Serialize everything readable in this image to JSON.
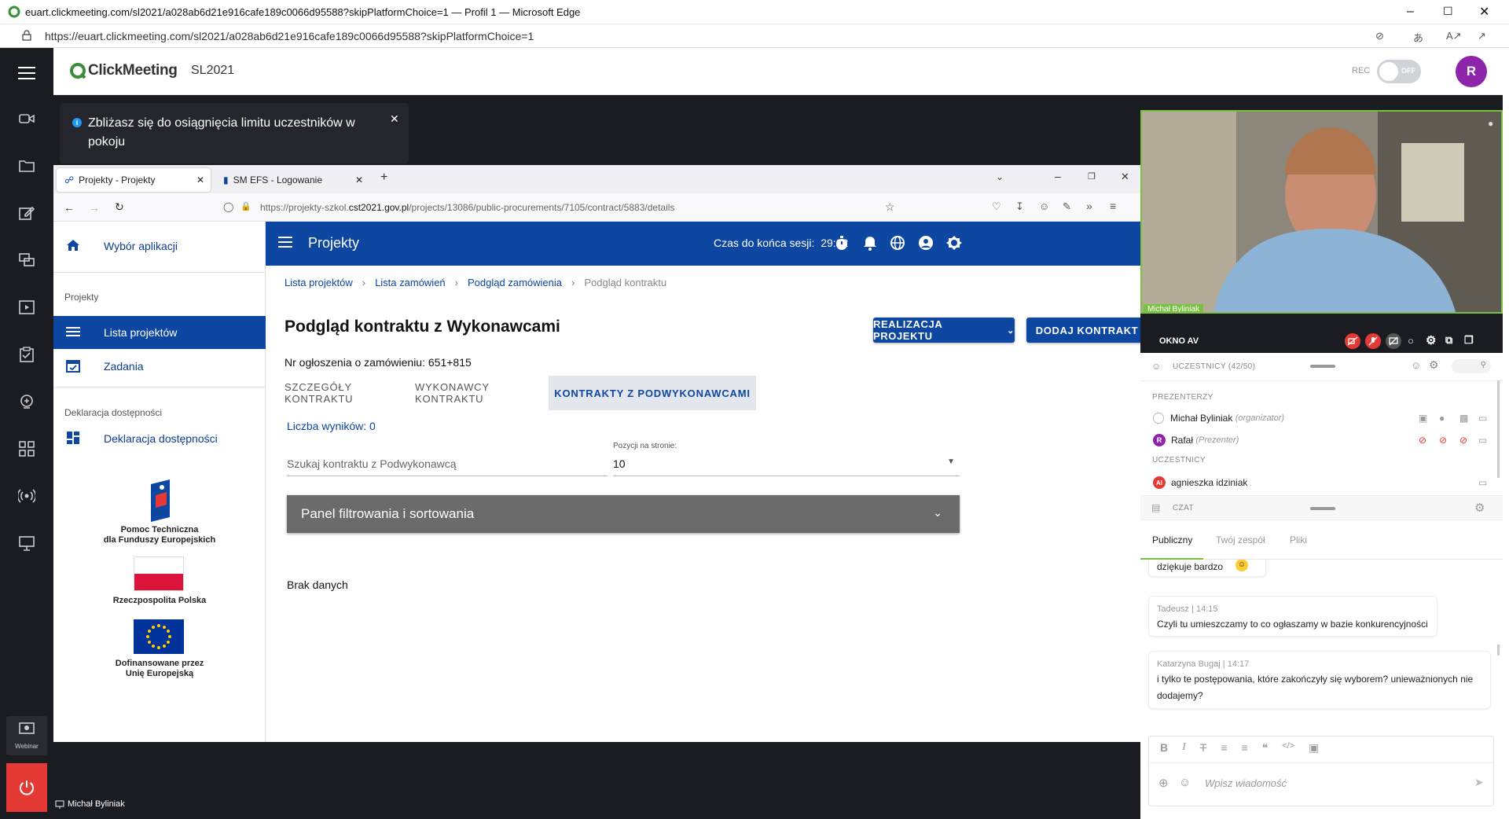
{
  "window": {
    "title": "euart.clickmeeting.com/sl2021/a028ab6d21e916cafe189c0066d95588?skipPlatformChoice=1 — Profil 1 — Microsoft Edge",
    "url": "https://euart.clickmeeting.com/sl2021/a028ab6d21e916cafe189c0066d95588?skipPlatformChoice=1"
  },
  "cm": {
    "brand": "ClickMeeting",
    "room": "SL2021",
    "rec_label": "REC",
    "rec_toggle": "OFF",
    "avatar": "R",
    "webinar_label": "Webinar",
    "bottom_presenter": "Michał Byliniak"
  },
  "toast": {
    "text": "Zbliżasz się do osiągnięcia limitu uczestników w pokoju"
  },
  "firefox": {
    "tabs": [
      {
        "label": "Projekty - Projekty"
      },
      {
        "label": "SM EFS - Logowanie"
      }
    ],
    "url_prefix": "https://projekty-szkol.",
    "url_domain": "cst2021.gov.pl",
    "url_path": "/projects/13086/public-procurements/7105/contract/5883/details"
  },
  "app": {
    "nav": {
      "app_choice": "Wybór aplikacji",
      "projects_header": "Projekty",
      "projects_list": "Lista projektów",
      "tasks": "Zadania",
      "accessibility_header": "Deklaracja dostępności",
      "accessibility": "Deklaracja dostępności",
      "logo1_line1": "Pomoc Techniczna",
      "logo1_line2": "dla Funduszy Europejskich",
      "logo2": "Rzeczpospolita Polska",
      "logo3_line1": "Dofinansowane przez",
      "logo3_line2": "Unię Europejską"
    },
    "appbar": {
      "title": "Projekty",
      "session_label": "Czas do końca sesji:",
      "session_time": "29:02"
    },
    "breadcrumb": [
      "Lista projektów",
      "Lista zamówień",
      "Podgląd zamówienia",
      "Podgląd kontraktu"
    ],
    "page_title": "Podgląd kontraktu z Wykonawcami",
    "btn_realizacja": "REALIZACJA PROJEKTU",
    "btn_dodaj": "DODAJ KONTRAKT",
    "announcement": "Nr ogłoszenia o zamówieniu: 651+815",
    "tabs": [
      "SZCZEGÓŁY KONTRAKTU",
      "WYKONAWCY KONTRAKTU",
      "KONTRAKTY Z PODWYKONAWCAMI"
    ],
    "results": "Liczba wyników: 0",
    "search_placeholder": "Szukaj kontraktu z Podwykonawcą",
    "per_page_label": "Pozycji na stronie:",
    "per_page_value": "10",
    "filter_panel": "Panel filtrowania i sortowania",
    "no_data": "Brak danych"
  },
  "panel": {
    "video_name": "Michał Byliniak",
    "av_label": "OKNO AV",
    "participants_label": "UCZESTNICY (42/50)",
    "presenters_header": "PREZENTERZY",
    "presenters": [
      {
        "name": "Michał Byliniak",
        "role": "(organizator)"
      },
      {
        "name": "Rafał",
        "role": "(Prezenter)",
        "avatar": "R"
      }
    ],
    "participants_header": "UCZESTNICY",
    "participants": [
      {
        "name": "agnieszka idziniak",
        "avatar": "AI"
      }
    ],
    "chat_label": "CZAT",
    "chat_tabs": [
      "Publiczny",
      "Twój zespół",
      "Pliki"
    ],
    "messages": [
      {
        "author": "",
        "time": "",
        "text": "dziękuje bardzo"
      },
      {
        "author": "Tadeusz",
        "time": "14:15",
        "text": "Czyli tu umieszczamy to co ogłaszamy w bazie konkurencyjności"
      },
      {
        "author": "Katarzyna Bugaj",
        "time": "14:17",
        "text": "i tylko te postępowania, które zakończyły się wyborem? unieważnionych nie dodajemy?"
      }
    ],
    "input_placeholder": "Wpisz wiadomość"
  },
  "colors": {
    "brand_blue": "#0d47a1",
    "cm_purple": "#8e24aa",
    "cm_green": "#7ac142",
    "danger": "#e53935"
  }
}
